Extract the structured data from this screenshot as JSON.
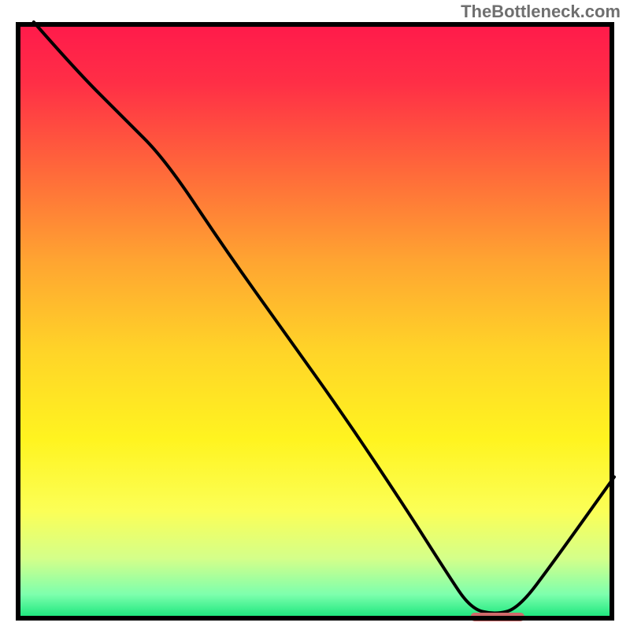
{
  "watermark": "TheBottleneck.com",
  "chart_data": {
    "type": "line",
    "title": "",
    "xlabel": "",
    "ylabel": "",
    "xlim": [
      0,
      100
    ],
    "ylim": [
      0,
      100
    ],
    "description": "Bottleneck percentage curve over a red-to-green vertical gradient background. The black curve starts at top-left (high bottleneck), descends with a slope change around x≈25, bottoms out near zero around x≈78, stays flat briefly, then rises toward the right edge. A short red horizontal marker sits on the x-axis around x≈76–84.",
    "series": [
      {
        "name": "bottleneck-curve",
        "x": [
          3,
          10,
          18,
          25,
          35,
          45,
          55,
          65,
          72,
          76,
          80,
          84,
          90,
          100
        ],
        "y": [
          100,
          92,
          84,
          77,
          62,
          48,
          34,
          19,
          8,
          2,
          1,
          2,
          10,
          24
        ]
      }
    ],
    "marker": {
      "x_start": 76,
      "x_end": 85,
      "y": 0,
      "color": "#cf6a6a"
    },
    "gradient_stops": [
      {
        "offset": 0.0,
        "color": "#ff1a4b"
      },
      {
        "offset": 0.1,
        "color": "#ff2f46"
      },
      {
        "offset": 0.25,
        "color": "#ff6a3a"
      },
      {
        "offset": 0.4,
        "color": "#ffa531"
      },
      {
        "offset": 0.55,
        "color": "#ffd428"
      },
      {
        "offset": 0.7,
        "color": "#fff420"
      },
      {
        "offset": 0.82,
        "color": "#fbff57"
      },
      {
        "offset": 0.9,
        "color": "#d4ff8a"
      },
      {
        "offset": 0.96,
        "color": "#7dffad"
      },
      {
        "offset": 1.0,
        "color": "#17e67b"
      }
    ],
    "frame_color": "#000000",
    "frame_width": 6
  }
}
